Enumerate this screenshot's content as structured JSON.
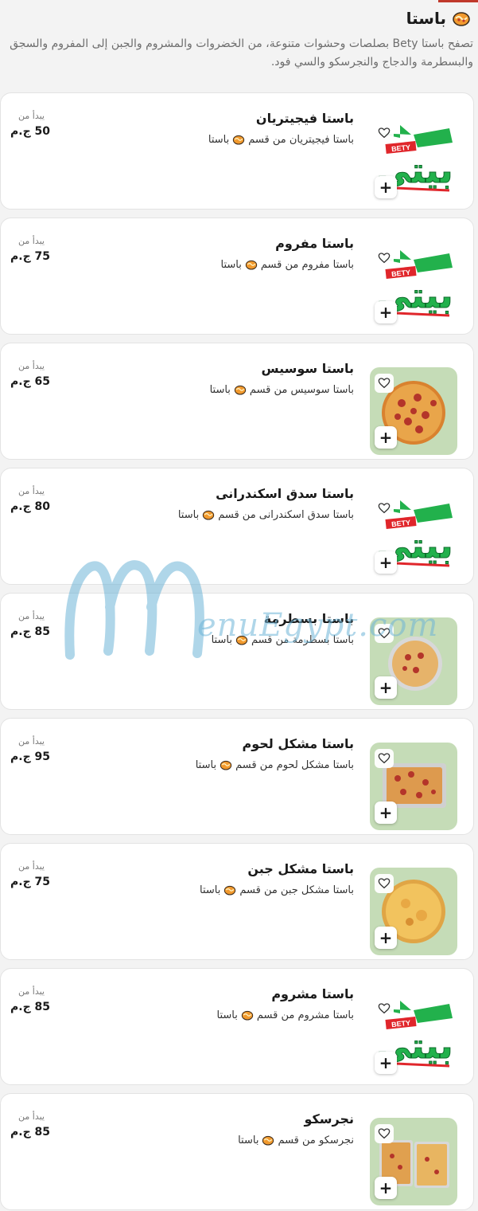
{
  "section": {
    "icon": "pasta-bowl-icon",
    "title": "باستا",
    "description": "تصفح باستا Bety بصلصات وحشوات متنوعة، من الخضروات والمشروم والجبن إلى المفروم والسجق والبسطرمة والدجاج والنجرسكو والسي فود."
  },
  "price_label": "يبدأ من",
  "watermark": {
    "mark": "M",
    "text": "enuEgypt.com"
  },
  "brand_logo": {
    "script": "بيتي",
    "wordmark": "BETY",
    "colors": {
      "red": "#e0262b",
      "green": "#22b14c"
    }
  },
  "items": [
    {
      "name": "باستا فيجيتريان",
      "subtitle_prefix": "باستا فيجيتريان من قسم",
      "category": "باستا",
      "price": "50 ج.م",
      "image": "logo"
    },
    {
      "name": "باستا مفروم",
      "subtitle_prefix": "باستا مفروم من قسم",
      "category": "باستا",
      "price": "75 ج.م",
      "image": "logo"
    },
    {
      "name": "باستا سوسيس",
      "subtitle_prefix": "باستا سوسيس من قسم",
      "category": "باستا",
      "price": "65 ج.م",
      "image": "photo-pizza"
    },
    {
      "name": "باستا سدق اسكندرانى",
      "subtitle_prefix": "باستا سدق اسكندرانى من قسم",
      "category": "باستا",
      "price": "80 ج.م",
      "image": "logo"
    },
    {
      "name": "باستا بسطرمة",
      "subtitle_prefix": "باستا بسطرمة من قسم",
      "category": "باستا",
      "price": "85 ج.م",
      "image": "photo-round-tray"
    },
    {
      "name": "باستا مشكل لحوم",
      "subtitle_prefix": "باستا مشكل لحوم من قسم",
      "category": "باستا",
      "price": "95 ج.م",
      "image": "photo-rect-tray"
    },
    {
      "name": "باستا مشكل جبن",
      "subtitle_prefix": "باستا مشكل جبن من قسم",
      "category": "باستا",
      "price": "75 ج.م",
      "image": "photo-cheese"
    },
    {
      "name": "باستا مشروم",
      "subtitle_prefix": "باستا مشروم من قسم",
      "category": "باستا",
      "price": "85 ج.م",
      "image": "logo"
    },
    {
      "name": "نجرسكو",
      "subtitle_prefix": "نجرسكو من قسم",
      "category": "باستا",
      "price": "85 ج.م",
      "image": "photo-two-trays"
    }
  ]
}
